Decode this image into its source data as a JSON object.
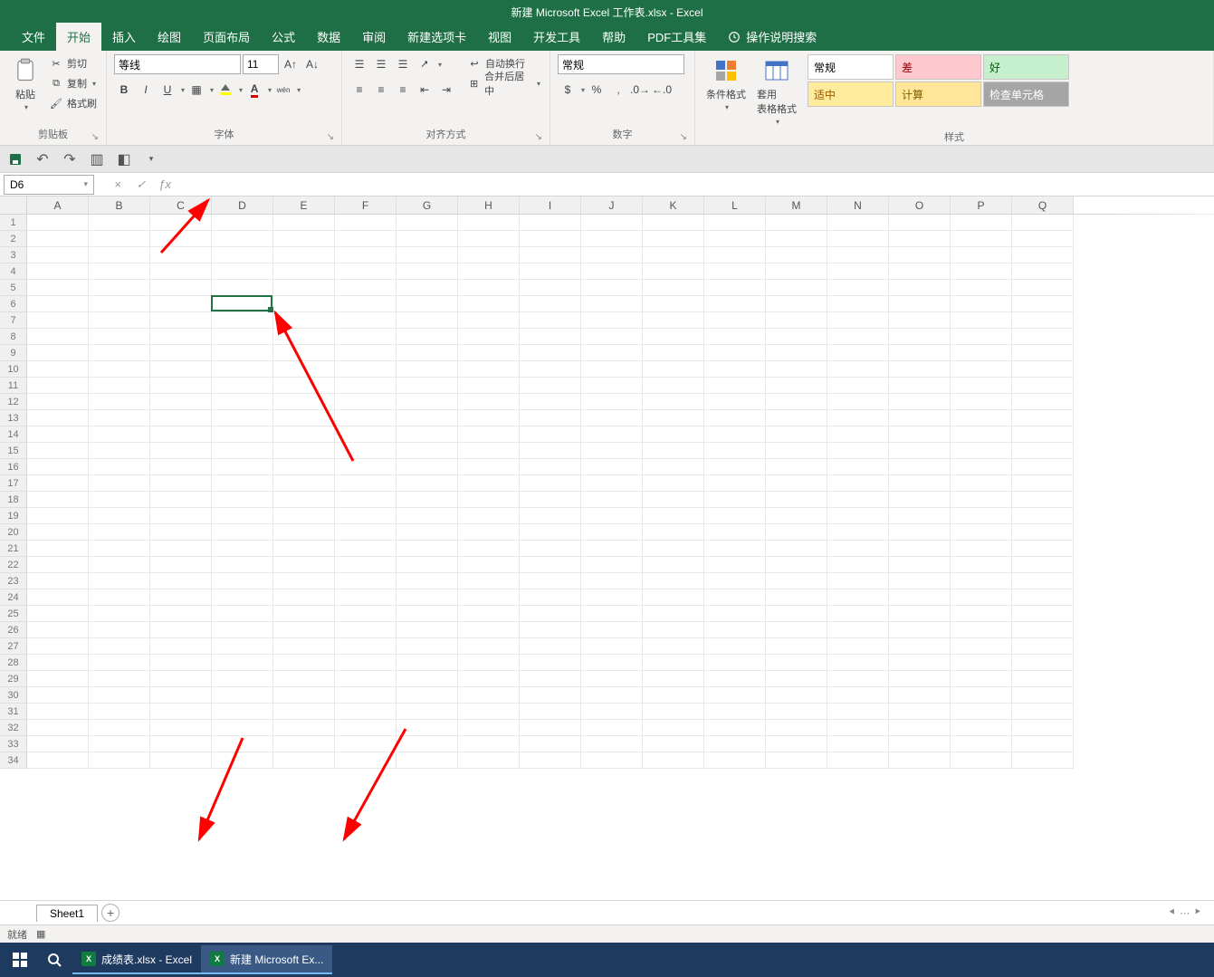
{
  "title": "新建 Microsoft Excel 工作表.xlsx  -  Excel",
  "tabs": [
    "文件",
    "开始",
    "插入",
    "绘图",
    "页面布局",
    "公式",
    "数据",
    "审阅",
    "新建选项卡",
    "视图",
    "开发工具",
    "帮助",
    "PDF工具集"
  ],
  "active_tab_index": 1,
  "tell_me": "操作说明搜索",
  "clipboard": {
    "cut": "剪切",
    "copy": "复制",
    "painter": "格式刷",
    "paste": "粘贴",
    "group": "剪贴板"
  },
  "font": {
    "name": "等线",
    "size": "11",
    "group": "字体"
  },
  "align": {
    "wrap": "自动换行",
    "merge": "合并后居中",
    "group": "对齐方式"
  },
  "number": {
    "format": "常规",
    "group": "数字"
  },
  "styles": {
    "cond": "条件格式",
    "table": "套用\n表格格式",
    "items": [
      {
        "label": "常规",
        "bg": "#ffffff",
        "fg": "#000"
      },
      {
        "label": "差",
        "bg": "#ffc7ce",
        "fg": "#9c0006"
      },
      {
        "label": "好",
        "bg": "#c6efce",
        "fg": "#006100"
      },
      {
        "label": "适中",
        "bg": "#ffeb9c",
        "fg": "#9c5700"
      },
      {
        "label": "计算",
        "bg": "#ffe699",
        "fg": "#7f6000"
      },
      {
        "label": "检查单元格",
        "bg": "#a5a5a5",
        "fg": "#ffffff"
      }
    ],
    "group": "样式"
  },
  "namebox": "D6",
  "formula": "",
  "columns": [
    "A",
    "B",
    "C",
    "D",
    "E",
    "F",
    "G",
    "H",
    "I",
    "J",
    "K",
    "L",
    "M",
    "N",
    "O",
    "P",
    "Q"
  ],
  "row_count": 34,
  "selected": {
    "row": 6,
    "col": 4
  },
  "sheet_tab": "Sheet1",
  "status": "就绪",
  "taskbar": {
    "items": [
      {
        "label": "成绩表.xlsx - Excel",
        "state": "running"
      },
      {
        "label": "新建 Microsoft Ex...",
        "state": "active"
      }
    ]
  }
}
